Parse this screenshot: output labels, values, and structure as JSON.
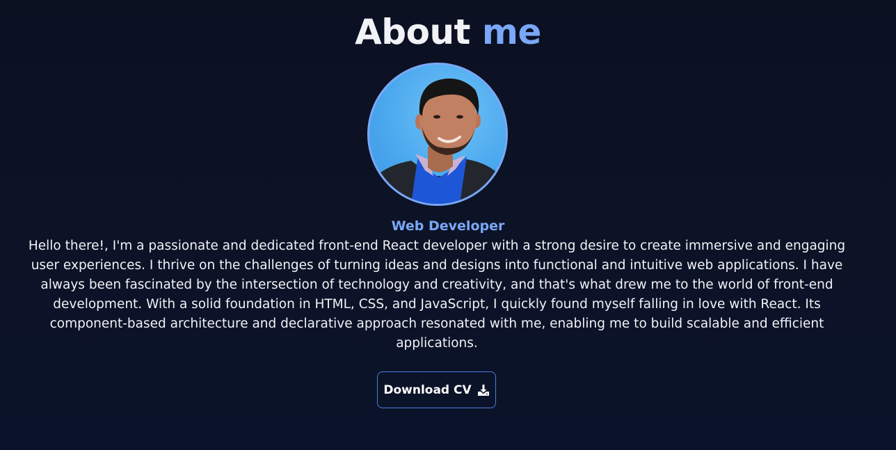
{
  "heading": {
    "main": "About",
    "accent": "me"
  },
  "profile": {
    "photo_icon": "portrait-photo",
    "role": "Web Developer",
    "bio": "Hello there!, I'm a passionate and dedicated front-end React developer with a strong desire to create immersive and engaging user experiences. I thrive on the challenges of turning ideas and designs into functional and intuitive web applications. I have always been fascinated by the intersection of technology and creativity, and that's what drew me to the world of front-end development. With a solid foundation in HTML, CSS, and JavaScript, I quickly found myself falling in love with React. Its component-based architecture and declarative approach resonated with me, enabling me to build scalable and efficient applications."
  },
  "cta": {
    "label": "Download CV",
    "icon": "download-icon"
  },
  "colors": {
    "background": "#0b1021",
    "accent": "#7aa7f7",
    "text": "#f1f2f6",
    "button_border": "#4d7fe0"
  }
}
